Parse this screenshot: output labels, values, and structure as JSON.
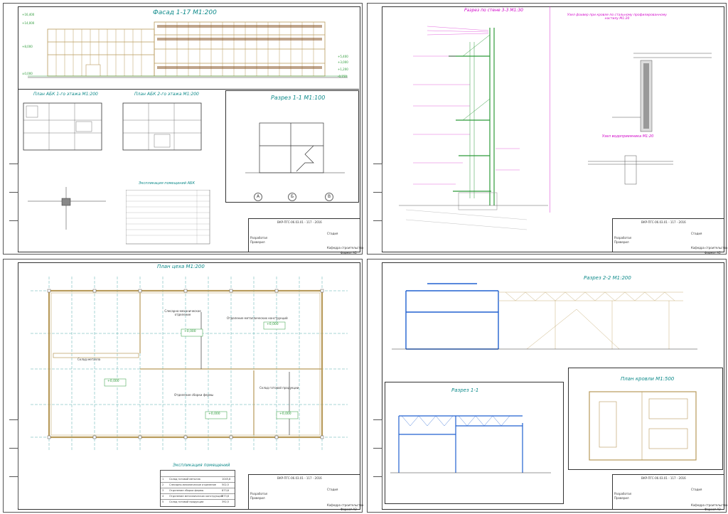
{
  "sheet1": {
    "facade_title": "Фасад 1-17 М1:200",
    "plan1_title": "План АБК 1-го этажа М1:200",
    "plan2_title": "План АБК 2-го этажа М1:200",
    "section_title": "Разрез 1-1 М1:100",
    "legend_title": "Экспликация помещений АБК",
    "grid_marks": [
      "А",
      "Б",
      "В"
    ],
    "facade_levels": [
      "+16,400",
      "+14,000",
      "+8,000",
      "+5,400",
      "+3,000",
      "+1,200",
      "±0,000",
      "-0,150"
    ],
    "format": "Формат А2"
  },
  "sheet2": {
    "section_title": "Разрез по стене 3-3 М1:30",
    "node1_title": "Узел фахвер при кровле по стальному профилированному настилу М1:20",
    "node2_title": "Узел водоприемника М1:20",
    "format": "Формат А2"
  },
  "sheet3": {
    "plan_title": "План цеха М1:200",
    "legend_title": "Экспликация помещений",
    "legend_rows": [
      {
        "n": "1",
        "name": "Склад готовой металла",
        "area": "1045,8"
      },
      {
        "n": "2",
        "name": "Слесарно-механическое отделение",
        "area": "502,5"
      },
      {
        "n": "3",
        "name": "Отделение сборки фермы",
        "area": "873,6"
      },
      {
        "n": "4",
        "name": "Отделение металлических конструкций",
        "area": "873,6"
      },
      {
        "n": "5",
        "name": "Склад готовой продукции",
        "area": "392,5"
      }
    ],
    "room_labels": [
      "Слесарно-механическое отделение",
      "Отделение металлических конструкций",
      "Склад металла",
      "Отделение сборки фермы",
      "Склад готовой продукции"
    ],
    "levels": [
      "+0,000",
      "+0,000",
      "+0,000",
      "+0,000",
      "+0,000"
    ],
    "format": "Формат А2"
  },
  "sheet4": {
    "section22_title": "Разрез 2-2 М1:200",
    "section11_title": "Разрез 1-1",
    "roof_title": "План кровли М1:500",
    "format": "Формат А2"
  },
  "titleblock": {
    "code": "ВКР-ПГС-06.03.01 - 117 - 2016",
    "header_labels": [
      "Изм.",
      "Кол.уч",
      "Лист",
      "№док.",
      "Подп.",
      "Дата"
    ],
    "roles": [
      "Разработал",
      "Проверил"
    ],
    "stage_labels": [
      "Стадия",
      "Лист",
      "Листов"
    ],
    "stage_values": [
      "ВР",
      "1",
      "4"
    ],
    "org": "Кафедра строительства"
  },
  "colors": {
    "frame": "#333333",
    "teal": "#0d8a8a",
    "magenta": "#d000c8",
    "green": "#2e9b3a",
    "blue": "#2060d0",
    "tan": "#b89a5a",
    "brown": "#8a5a2a"
  }
}
